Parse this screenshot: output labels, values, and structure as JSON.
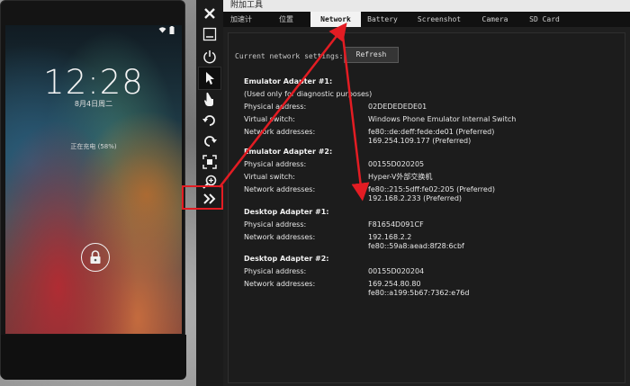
{
  "phone": {
    "time": "12:28",
    "date": "8月4日周二",
    "charging_text": "正在充电 (58%)"
  },
  "toolbar": {
    "icons": [
      "close-icon",
      "minimize-icon",
      "power-icon",
      "pointer-icon",
      "touch-icon",
      "rotate-left-icon",
      "rotate-right-icon",
      "fit-to-screen-icon",
      "zoom-icon",
      "expand-tools-icon"
    ]
  },
  "tools_window": {
    "title": "附加工具",
    "tabs": [
      "加速计",
      "位置",
      "Network",
      "Battery",
      "Screenshot",
      "Camera",
      "SD Card"
    ],
    "active_tab": "Network",
    "settings_label": "Current network settings:",
    "refresh_label": "Refresh",
    "adapters": [
      {
        "title": "Emulator Adapter #1:",
        "note": "(Used only for diagnostic purposes)",
        "rows": [
          {
            "label": "Physical address:",
            "value": "02DEDEDEDE01"
          },
          {
            "label": "Virtual switch:",
            "value": "Windows Phone Emulator Internal Switch"
          },
          {
            "label": "Network addresses:",
            "value": "fe80::de:deff:fede:de01 (Preferred)",
            "value2": "169.254.109.177 (Preferred)"
          }
        ]
      },
      {
        "title": "Emulator Adapter #2:",
        "rows": [
          {
            "label": "Physical address:",
            "value": "00155D020205"
          },
          {
            "label": "Virtual switch:",
            "value": "Hyper-V外部交换机"
          },
          {
            "label": "Network addresses:",
            "value": "fe80::215:5dff:fe02:205 (Preferred)",
            "value2": "192.168.2.233 (Preferred)"
          }
        ]
      },
      {
        "title": "Desktop Adapter #1:",
        "rows": [
          {
            "label": "Physical address:",
            "value": "F81654D091CF"
          },
          {
            "label": "Network addresses:",
            "value": "192.168.2.2",
            "value2": "fe80::59a8:aead:8f28:6cbf"
          }
        ]
      },
      {
        "title": "Desktop Adapter #2:",
        "rows": [
          {
            "label": "Physical address:",
            "value": "00155D020204"
          },
          {
            "label": "Network addresses:",
            "value": "169.254.80.80",
            "value2": "fe80::a199:5b67:7362:e76d"
          }
        ]
      }
    ]
  },
  "colors": {
    "annotation": "#e31c23",
    "panel_bg": "#1c1c1c",
    "active_tab_bg": "#f2f2f2"
  }
}
